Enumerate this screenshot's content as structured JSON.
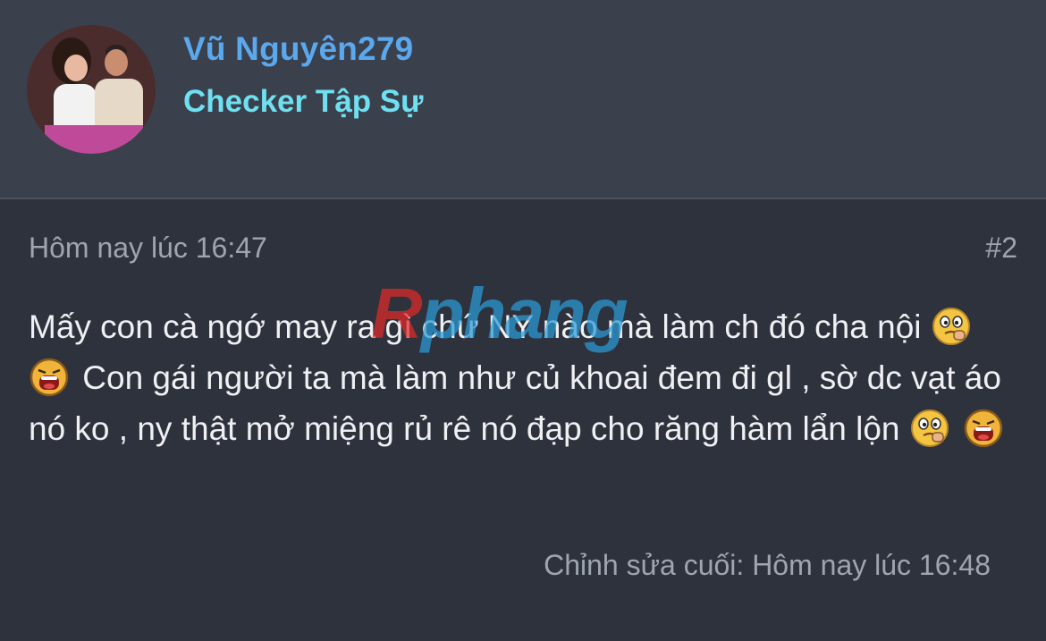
{
  "user": {
    "name": "Vũ Nguyên279",
    "title": "Checker Tập Sự"
  },
  "post": {
    "time": "Hôm nay lúc 16:47",
    "number": "#2",
    "segments": [
      "Mấy con cà ngớ may ra gì chứ NY nào mà làm ch đó cha nội",
      "Con gái người ta mà làm như củ khoai đem đi gl , sờ dc vạt áo nó ko , ny thật mở miệng rủ rê nó đạp cho răng hàm lẩn lộn"
    ],
    "emojis": [
      "thinking-emoji",
      "shouting-emoji"
    ],
    "edited": "Chỉnh sửa cuối: Hôm nay lúc 16:48"
  },
  "watermark": {
    "first": "R",
    "rest": "phang"
  },
  "colors": {
    "background": "#2e323c",
    "header": "#3b404d",
    "username": "#5aa8ee",
    "usertitle": "#6ee0f0",
    "muted": "#9fa5b0",
    "text": "#eef0f3"
  }
}
